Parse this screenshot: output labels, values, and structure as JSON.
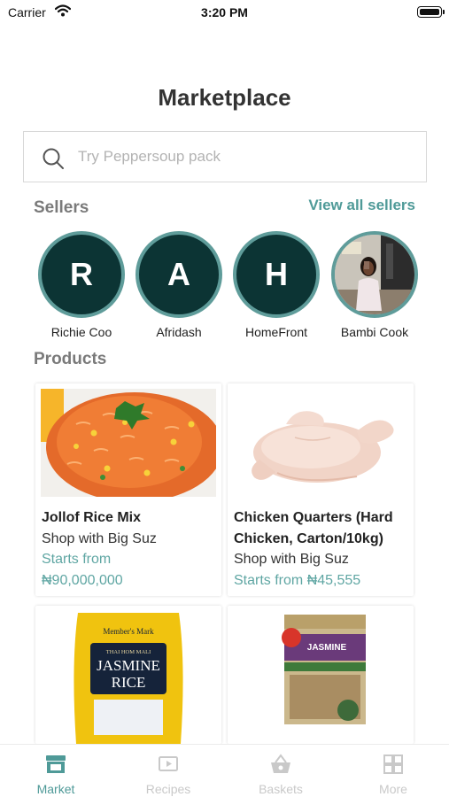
{
  "status_bar": {
    "carrier": "Carrier",
    "time": "3:20 PM"
  },
  "page": {
    "title": "Marketplace"
  },
  "search": {
    "placeholder": "Try Peppersoup pack",
    "value": ""
  },
  "sellers_section": {
    "title": "Sellers",
    "view_all_label": "View all sellers",
    "items": [
      {
        "initial": "R",
        "name": "Richie Coo"
      },
      {
        "initial": "A",
        "name": "Afridash"
      },
      {
        "initial": "H",
        "name": "HomeFront"
      },
      {
        "initial": "",
        "name": "Bambi Cook"
      }
    ]
  },
  "products_section": {
    "title": "Products",
    "items": [
      {
        "name": "Jollof Rice Mix",
        "shop": "Shop with Big Suz",
        "price_prefix": "Starts from",
        "price": "₦90,000,000"
      },
      {
        "name": "Chicken Quarters (Hard Chicken, Carton/10kg)",
        "shop": "Shop with Big Suz",
        "price_prefix": "Starts from",
        "price": "₦45,555"
      },
      {
        "name": "",
        "shop": "",
        "price_prefix": "",
        "price": ""
      },
      {
        "name": "",
        "shop": "",
        "price_prefix": "",
        "price": ""
      }
    ]
  },
  "product_images": {
    "jasmine_rice_brand": "Member's Mark",
    "jasmine_rice_small": "THAI HOM MALI",
    "jasmine_rice_title_1": "JASMINE",
    "jasmine_rice_title_2": "RICE",
    "rice_box_title": "JASMINE"
  },
  "tab_bar": {
    "tabs": [
      {
        "label": "Market",
        "icon": "store-icon",
        "active": true
      },
      {
        "label": "Recipes",
        "icon": "video-play-icon",
        "active": false
      },
      {
        "label": "Baskets",
        "icon": "basket-icon",
        "active": false
      },
      {
        "label": "More",
        "icon": "grid-icon",
        "active": false
      }
    ]
  },
  "colors": {
    "accent": "#4f9a98",
    "price": "#5fa6a3",
    "avatar_fill": "#0c3434",
    "avatar_ring": "#5f9c9a",
    "section_label": "#7a7a7a",
    "tab_inactive": "#c9c9c9"
  }
}
